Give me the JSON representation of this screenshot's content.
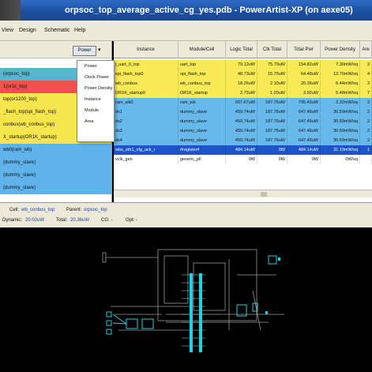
{
  "window": {
    "title": "orpsoc_top_average_active_cg_yes.pdb - PowerArtist-XP (on aexe05)"
  },
  "menu": [
    "View",
    "Design",
    "Schematic",
    "Help"
  ],
  "left_toolbar": {
    "dropdown_value": "Power"
  },
  "tree": [
    {
      "label": "(orpsoc_top)",
      "bg": "#54b8c8"
    },
    {
      "label": "1(or1k_top)",
      "bg": "#f2504a"
    },
    {
      "label": "top(or1200_top)",
      "bg": "#f6e64d"
    },
    {
      "label": "_flash_top(spi_flash_top)",
      "bg": "#f6e64d"
    },
    {
      "label": "conbus(wb_conbus_top)",
      "bg": "#f6e64d"
    },
    {
      "label": "X_startup(OR1K_startup)",
      "bg": "#f6e64d"
    },
    {
      "label": "wb0(ram_wb)",
      "bg": "#5fb2ea"
    },
    {
      "label": "(dummy_slave)",
      "bg": "#5fb2ea"
    },
    {
      "label": "(dummy_slave)",
      "bg": "#5fb2ea"
    },
    {
      "label": "(dummy_slave)",
      "bg": "#5fb2ea"
    }
  ],
  "popup": [
    "Power",
    "Clock Power",
    "Power Density",
    "Instance",
    "Module",
    "Area"
  ],
  "table": {
    "headers": [
      "Instance",
      "Module/Cell",
      "Logic Total",
      "Clk Total",
      "Total Pwr",
      "Power Density",
      "Are"
    ],
    "rows": [
      {
        "bg": "#f7ea55",
        "cells": [
          "i_uart_0_top",
          "uart_top",
          "79.12uW",
          "75.70uW",
          "154.82uW",
          "7.30mW/sq",
          "2"
        ]
      },
      {
        "bg": "#f7ea55",
        "cells": [
          "spi_flash_top0",
          "spi_flash_top",
          "48.73uW",
          "15.75uW",
          "64.48uW",
          "13.70mW/sq",
          "4"
        ]
      },
      {
        "bg": "#f7ea55",
        "cells": [
          "wb_conbus",
          "wb_conbus_top",
          "18.26uW",
          "2.10uW",
          "20.36uW",
          "6.44mW/sq",
          "3"
        ]
      },
      {
        "bg": "#f7ea55",
        "cells": [
          "OR1K_startup0",
          "OR1K_startup",
          "2.73uW",
          "1.20uW",
          "3.92uW",
          "5.48mW/sq",
          "7"
        ]
      },
      {
        "bg": "#67b9ec",
        "cells": [
          "ram_wb0",
          "ram_wb",
          "607.67uW",
          "187.76uW",
          "795.43uW",
          "3.32mW/sq",
          "2"
        ]
      },
      {
        "bg": "#67b9ec",
        "cells": [
          "ds1",
          "dummy_slave",
          "459.74uW",
          "187.76uW",
          "647.49uW",
          "30.59mW/sq",
          "2"
        ]
      },
      {
        "bg": "#67b9ec",
        "cells": [
          "ds2",
          "dummy_slave",
          "459.74uW",
          "187.76uW",
          "647.49uW",
          "30.59mW/sq",
          "2"
        ]
      },
      {
        "bg": "#67b9ec",
        "cells": [
          "ds3",
          "dummy_slave",
          "459.74uW",
          "187.76uW",
          "647.49uW",
          "30.59mW/sq",
          "2"
        ]
      },
      {
        "bg": "#67b9ec",
        "cells": [
          "ds4",
          "dummy_slave",
          "459.74uW",
          "187.76uW",
          "647.49uW",
          "30.59mW/sq",
          "2"
        ]
      },
      {
        "bg": "#1d55c8",
        "fg": "#ffffff",
        "cells": [
          "wbs_eth1_cfg_ack_r",
          "#register#",
          "484.14uW",
          "0W",
          "484.14uW",
          "31.19mW/sq",
          "1"
        ]
      },
      {
        "bg": "#ffffff",
        "cells": [
          "vclk_gen",
          "generic_pll",
          "0W",
          "0W",
          "0W",
          "0W/sq",
          ""
        ]
      }
    ]
  },
  "status": {
    "cell_label": "Cell:",
    "cell_value": "wb_conbus_top",
    "parent_label": "Parent:",
    "parent_value": "orpsoc_top",
    "dynamic_label": "Dynamic:",
    "dynamic_value": "20.02uW",
    "total_label": "Total:",
    "total_value": "20.36uW",
    "cg_label": "CG: -",
    "opt_label": "Opt: -"
  }
}
